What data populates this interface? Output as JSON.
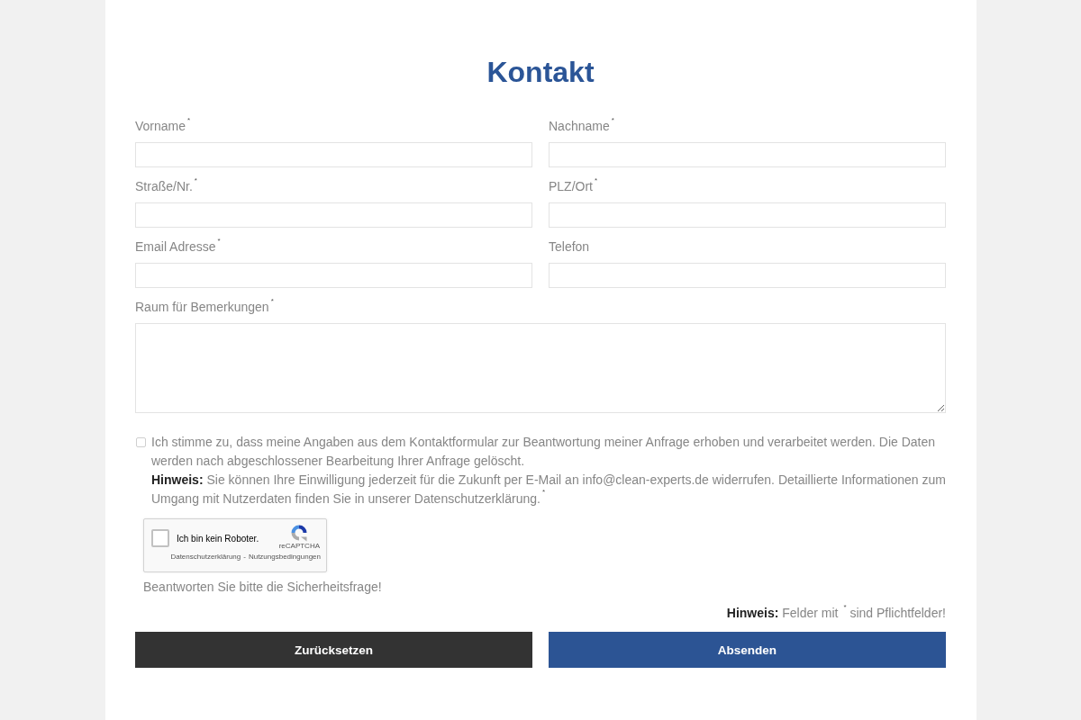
{
  "title": "Kontakt",
  "fields": [
    {
      "kind": "input",
      "label": "Vorname$^{*}$"
    },
    {
      "kind": "input",
      "label": "Nachname$^{*}$"
    },
    {
      "kind": "input",
      "label": "Straße/Nr.$^{*}$"
    },
    {
      "kind": "input",
      "label": "PLZ/Ort$^{*}$"
    },
    {
      "kind": "input",
      "label": "Email Adresse$^{*}$"
    },
    {
      "kind": "input",
      "label": "Telefon"
    },
    {
      "kind": "textarea",
      "label": "Raum für Bemerkungen$^{*}$"
    }
  ],
  "consent": {
    "checked": false,
    "text": "Ich stimme zu, dass meine Angaben aus dem Kontaktformular zur Beantwortung meiner Anfrage erhoben und verarbeitet werden. Die Daten werden nach abgeschlossener Bearbeitung Ihrer Anfrage gelöscht.",
    "note": "**Hinweis:** Sie können Ihre Einwilligung jederzeit für die Zukunft per E-Mail an info@clean-experts.de widerrufen. Detaillierte Informationen zum Umgang mit Nutzerdaten finden Sie in unserer Datenschutzerklärung.$^{*}$"
  },
  "captcha": {
    "checked": false,
    "label": "Ich bin kein Roboter.",
    "brand": "reCAPTCHA",
    "links": [
      "Datenschutzerklärung",
      "Nutzungsbedingungen"
    ],
    "separator": "-",
    "hint": "Beantworten Sie bitte die Sicherheitsfrage!"
  },
  "required_note": "**Hinweis:** Felder mit $^{*}$ sind Pflichtfelder!",
  "buttons": [
    {
      "kind": "reset",
      "label": "Zurücksetzen"
    },
    {
      "kind": "submit",
      "label": "Absenden"
    }
  ]
}
